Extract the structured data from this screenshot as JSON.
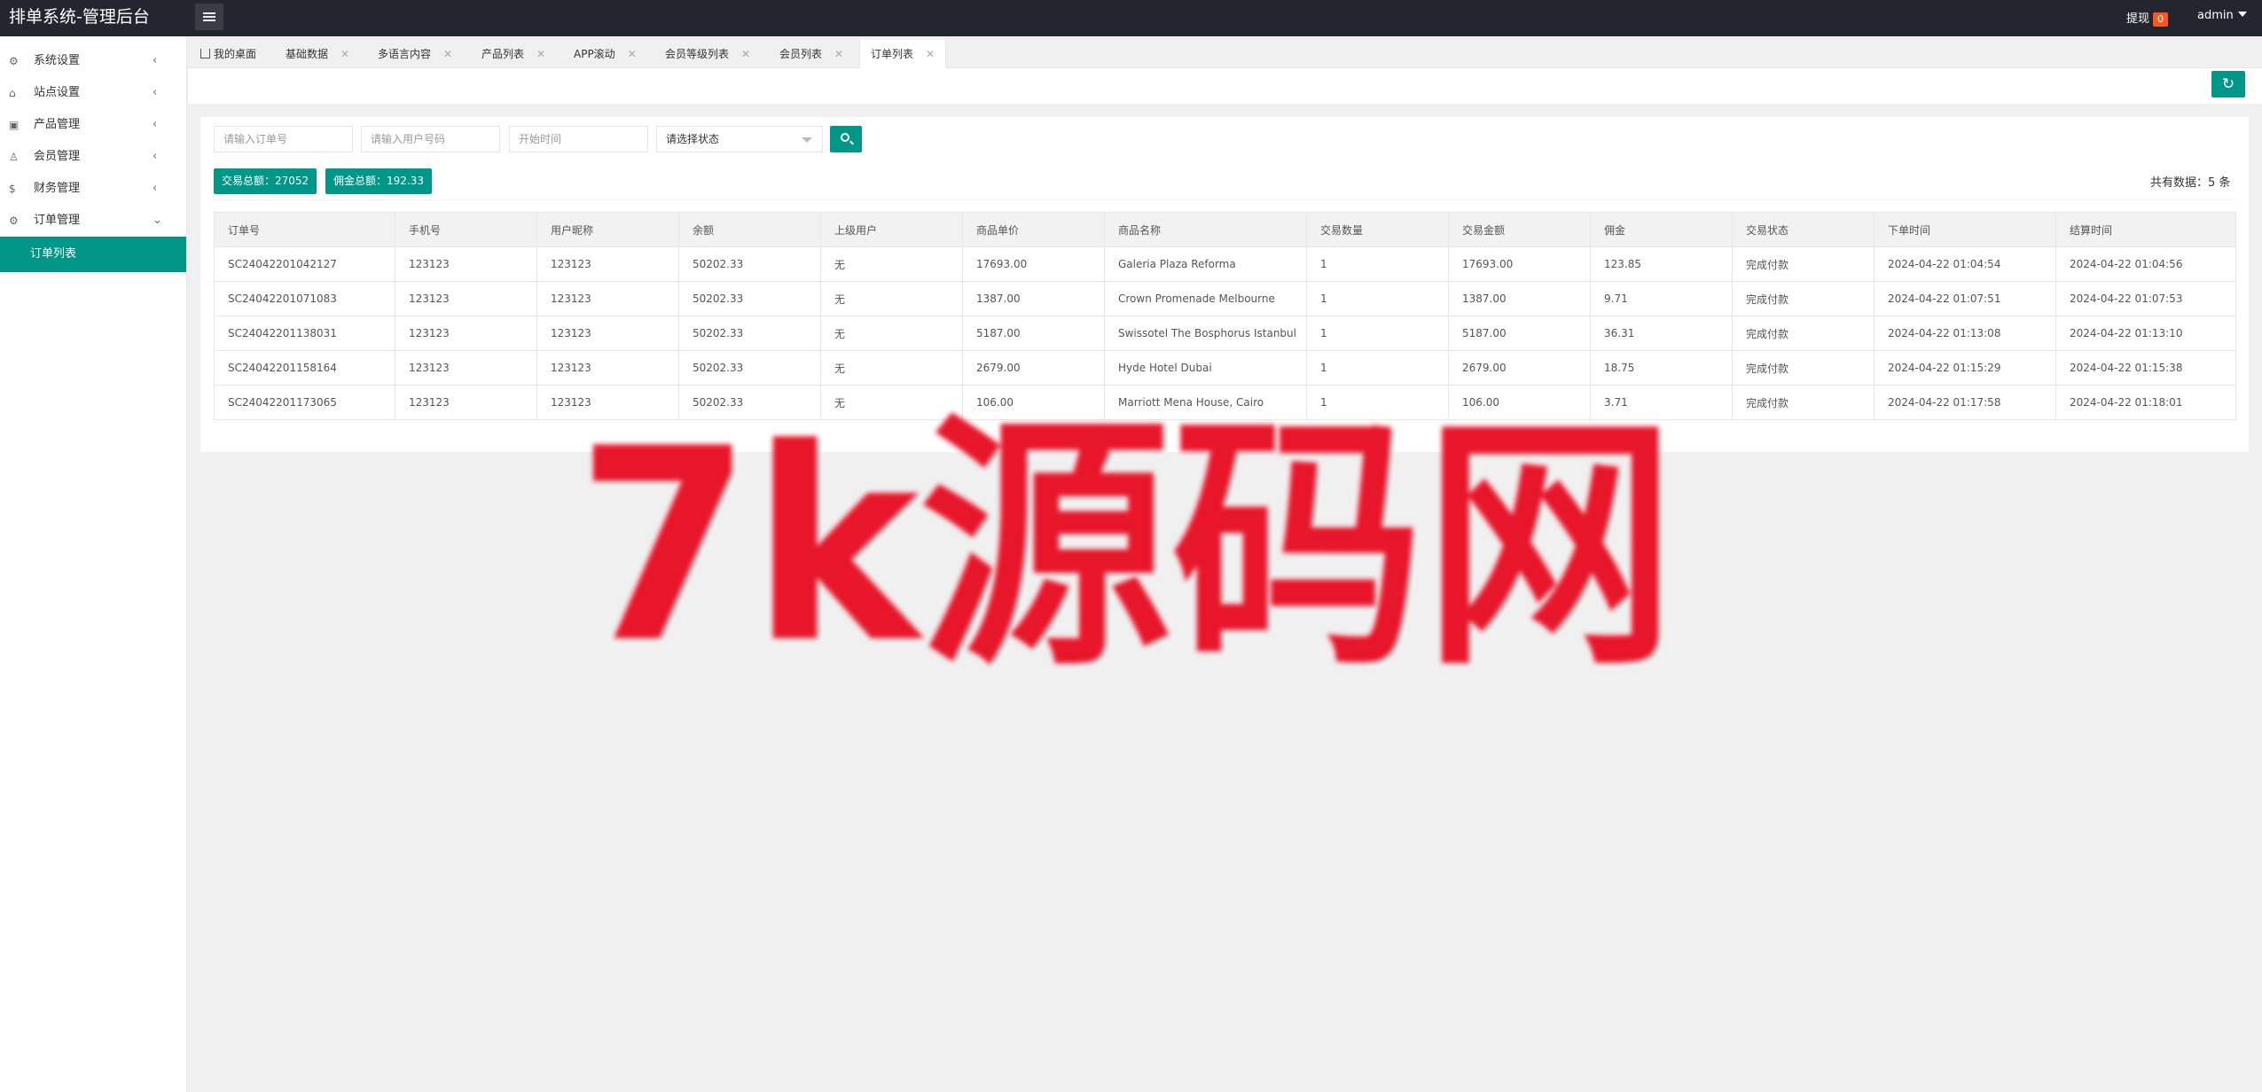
{
  "app": {
    "title": "排单系统-管理后台"
  },
  "header": {
    "withdraw_label": "提现",
    "withdraw_count": "0",
    "user": "admin"
  },
  "sidebar": {
    "items": [
      {
        "label": "系统设置",
        "icon": "gear-icon"
      },
      {
        "label": "站点设置",
        "icon": "home-icon"
      },
      {
        "label": "产品管理",
        "icon": "box-icon"
      },
      {
        "label": "会员管理",
        "icon": "user-icon"
      },
      {
        "label": "财务管理",
        "icon": "dollar-icon"
      },
      {
        "label": "订单管理",
        "icon": "gear-icon",
        "expanded": true
      }
    ],
    "active_sub": "订单列表"
  },
  "tabs": [
    {
      "label": "我的桌面"
    },
    {
      "label": "基础数据"
    },
    {
      "label": "多语言内容"
    },
    {
      "label": "产品列表"
    },
    {
      "label": "APP滚动"
    },
    {
      "label": "会员等级列表"
    },
    {
      "label": "会员列表"
    },
    {
      "label": "订单列表",
      "active": true
    }
  ],
  "filters": {
    "order_no_placeholder": "请输入订单号",
    "phone_placeholder": "请输入用户号码",
    "start_time_placeholder": "开始时间",
    "status_placeholder": "请选择状态"
  },
  "summary": {
    "trade_total": "交易总额：27052",
    "commission_total": "佣金总额：192.33",
    "total_count": "共有数据：5 条"
  },
  "table": {
    "headers": [
      "订单号",
      "手机号",
      "用户昵称",
      "余额",
      "上级用户",
      "商品单价",
      "商品名称",
      "交易数量",
      "交易金额",
      "佣金",
      "交易状态",
      "下单时间",
      "结算时间"
    ],
    "rows": [
      [
        "SC24042201042127",
        "123123",
        "123123",
        "50202.33",
        "无",
        "17693.00",
        "Galeria Plaza Reforma",
        "1",
        "17693.00",
        "123.85",
        "完成付款",
        "2024-04-22 01:04:54",
        "2024-04-22 01:04:56"
      ],
      [
        "SC24042201071083",
        "123123",
        "123123",
        "50202.33",
        "无",
        "1387.00",
        "Crown Promenade Melbourne",
        "1",
        "1387.00",
        "9.71",
        "完成付款",
        "2024-04-22 01:07:51",
        "2024-04-22 01:07:53"
      ],
      [
        "SC24042201138031",
        "123123",
        "123123",
        "50202.33",
        "无",
        "5187.00",
        "Swissotel The Bosphorus Istanbul",
        "1",
        "5187.00",
        "36.31",
        "完成付款",
        "2024-04-22 01:13:08",
        "2024-04-22 01:13:10"
      ],
      [
        "SC24042201158164",
        "123123",
        "123123",
        "50202.33",
        "无",
        "2679.00",
        "Hyde Hotel Dubai",
        "1",
        "2679.00",
        "18.75",
        "完成付款",
        "2024-04-22 01:15:29",
        "2024-04-22 01:15:38"
      ],
      [
        "SC24042201173065",
        "123123",
        "123123",
        "50202.33",
        "无",
        "106.00",
        "Marriott Mena House, Cairo",
        "1",
        "106.00",
        "3.71",
        "完成付款",
        "2024-04-22 01:17:58",
        "2024-04-22 01:18:01"
      ]
    ]
  },
  "watermark": {
    "text": "7k源码网",
    "color": "#e8132c"
  },
  "colors": {
    "accent": "#009688",
    "topbar": "#23262e",
    "badge": "#ff5722"
  }
}
